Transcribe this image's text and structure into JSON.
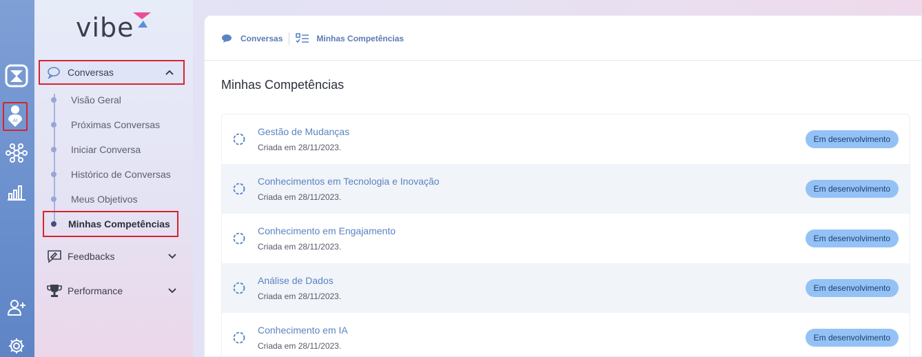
{
  "app": {
    "logo_text": "vibe",
    "brand_colors": {
      "pink": "#ec4d9a",
      "blue": "#5b8fd9",
      "highlight": "#d6232d"
    }
  },
  "rail": {
    "icons": [
      {
        "name": "vibe-app-icon"
      },
      {
        "name": "ai-profile-icon",
        "badge": "AI"
      },
      {
        "name": "network-icon"
      },
      {
        "name": "bar-chart-icon"
      },
      {
        "name": "add-user-icon"
      },
      {
        "name": "gear-icon"
      }
    ]
  },
  "sidebar": {
    "groups": [
      {
        "label": "Conversas",
        "icon": "chat-bubble-icon",
        "expanded": true
      },
      {
        "label": "Feedbacks",
        "icon": "feedback-icon",
        "expanded": false
      },
      {
        "label": "Performance",
        "icon": "trophy-icon",
        "expanded": false
      }
    ],
    "conversas_items": [
      {
        "label": "Visão Geral"
      },
      {
        "label": "Próximas Conversas"
      },
      {
        "label": "Iniciar Conversa"
      },
      {
        "label": "Histórico de Conversas"
      },
      {
        "label": "Meus Objetivos"
      },
      {
        "label": "Minhas Competências",
        "active": true
      }
    ]
  },
  "main": {
    "breadcrumb": [
      {
        "label": "Conversas",
        "icon": "chat-bubble-icon"
      },
      {
        "label": "Minhas Competências",
        "icon": "checklist-icon"
      }
    ],
    "title": "Minhas Competências",
    "competencies": [
      {
        "title": "Gestão de Mudanças",
        "date": "Criada em 28/11/2023.",
        "status": "Em desenvolvimento"
      },
      {
        "title": "Conhecimentos em Tecnologia e Inovação",
        "date": "Criada em 28/11/2023.",
        "status": "Em desenvolvimento"
      },
      {
        "title": "Conhecimento em Engajamento",
        "date": "Criada em 28/11/2023.",
        "status": "Em desenvolvimento"
      },
      {
        "title": "Análise de Dados",
        "date": "Criada em 28/11/2023.",
        "status": "Em desenvolvimento"
      },
      {
        "title": "Conhecimento em IA",
        "date": "Criada em 28/11/2023.",
        "status": "Em desenvolvimento"
      }
    ]
  }
}
